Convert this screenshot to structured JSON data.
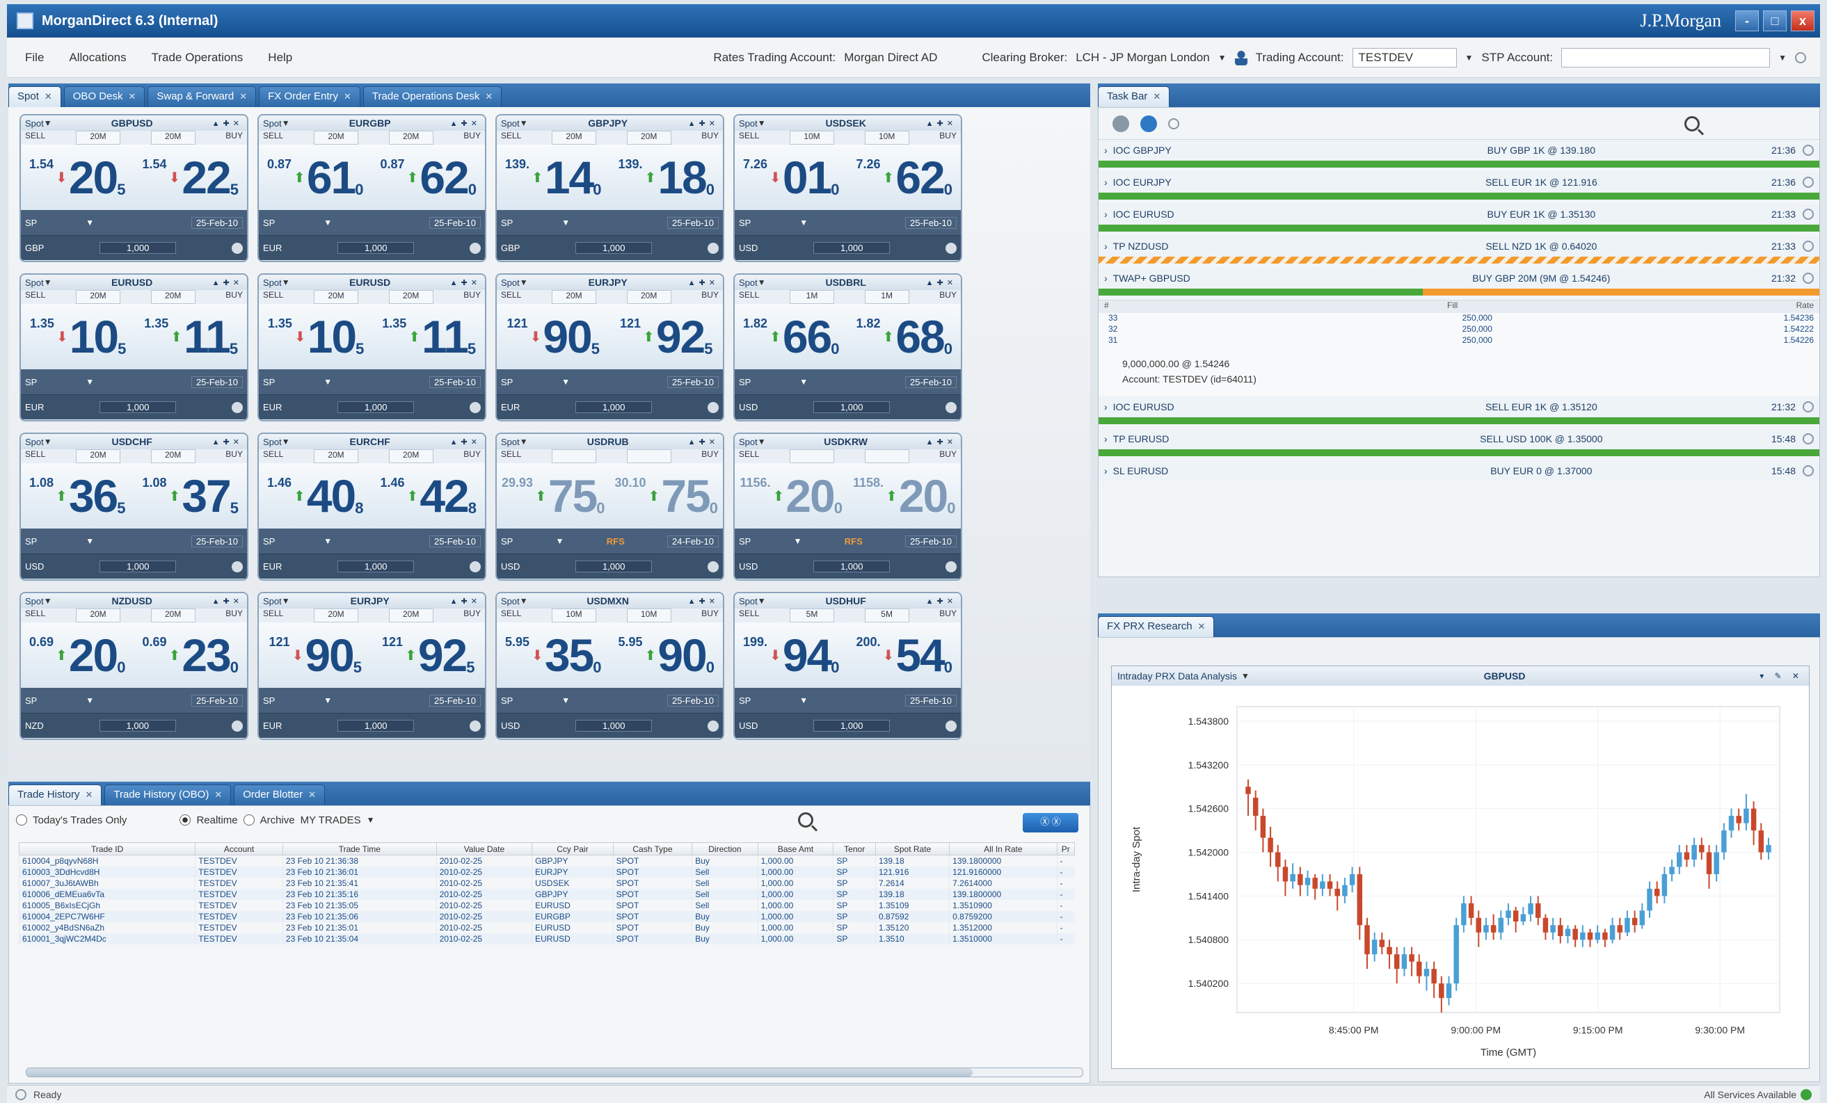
{
  "window": {
    "title": "MorganDirect 6.3 (Internal)",
    "brand": "J.P.Morgan",
    "minimize": "-",
    "maximize": "□",
    "close": "x"
  },
  "menu": {
    "file": "File",
    "allocations": "Allocations",
    "trade_operations": "Trade Operations",
    "help": "Help"
  },
  "context": {
    "rates_account_label": "Rates Trading Account:",
    "rates_account": "Morgan Direct AD",
    "clearing_label": "Clearing Broker:",
    "clearing_value": "LCH - JP Morgan London",
    "trading_label": "Trading Account:",
    "trading_value": "TESTDEV",
    "stp_label": "STP Account:",
    "stp_value": ""
  },
  "main_tabs": [
    {
      "label": "Spot"
    },
    {
      "label": "OBO Desk"
    },
    {
      "label": "Swap & Forward"
    },
    {
      "label": "FX Order Entry"
    },
    {
      "label": "Trade Operations Desk"
    }
  ],
  "tiles": [
    {
      "mode": "Spot",
      "pair": "GBPUSD",
      "sell": "SELL",
      "buy": "BUY",
      "sell_amt": "20M",
      "buy_amt": "20M",
      "bid_pre": "1.54",
      "bid_big": "20",
      "bid_pip": "5",
      "ask_pre": "1.54",
      "ask_big": "22",
      "ask_pip": "5",
      "bid_dir": "down",
      "ask_dir": "down",
      "tenor": "SP",
      "date": "25-Feb-10",
      "ccy": "GBP",
      "amount": "1,000",
      "rfs": "",
      "faded": false
    },
    {
      "mode": "Spot",
      "pair": "EURGBP",
      "sell": "SELL",
      "buy": "BUY",
      "sell_amt": "20M",
      "buy_amt": "20M",
      "bid_pre": "0.87",
      "bid_big": "61",
      "bid_pip": "0",
      "ask_pre": "0.87",
      "ask_big": "62",
      "ask_pip": "0",
      "bid_dir": "up",
      "ask_dir": "up",
      "tenor": "SP",
      "date": "25-Feb-10",
      "ccy": "EUR",
      "amount": "1,000",
      "rfs": "",
      "faded": false
    },
    {
      "mode": "Spot",
      "pair": "GBPJPY",
      "sell": "SELL",
      "buy": "BUY",
      "sell_amt": "20M",
      "buy_amt": "20M",
      "bid_pre": "139.",
      "bid_big": "14",
      "bid_pip": "0",
      "ask_pre": "139.",
      "ask_big": "18",
      "ask_pip": "0",
      "bid_dir": "up",
      "ask_dir": "up",
      "tenor": "SP",
      "date": "25-Feb-10",
      "ccy": "GBP",
      "amount": "1,000",
      "rfs": "",
      "faded": false
    },
    {
      "mode": "Spot",
      "pair": "USDSEK",
      "sell": "SELL",
      "buy": "BUY",
      "sell_amt": "10M",
      "buy_amt": "10M",
      "bid_pre": "7.26",
      "bid_big": "01",
      "bid_pip": "0",
      "ask_pre": "7.26",
      "ask_big": "62",
      "ask_pip": "0",
      "bid_dir": "down",
      "ask_dir": "up",
      "tenor": "SP",
      "date": "25-Feb-10",
      "ccy": "USD",
      "amount": "1,000",
      "rfs": "",
      "faded": false
    },
    {
      "mode": "Spot",
      "pair": "EURUSD",
      "sell": "SELL",
      "buy": "BUY",
      "sell_amt": "20M",
      "buy_amt": "20M",
      "bid_pre": "1.35",
      "bid_big": "10",
      "bid_pip": "5",
      "ask_pre": "1.35",
      "ask_big": "11",
      "ask_pip": "5",
      "bid_dir": "down",
      "ask_dir": "up",
      "tenor": "SP",
      "date": "25-Feb-10",
      "ccy": "EUR",
      "amount": "1,000",
      "rfs": "",
      "faded": false
    },
    {
      "mode": "Spot",
      "pair": "EURUSD",
      "sell": "SELL",
      "buy": "BUY",
      "sell_amt": "20M",
      "buy_amt": "20M",
      "bid_pre": "1.35",
      "bid_big": "10",
      "bid_pip": "5",
      "ask_pre": "1.35",
      "ask_big": "11",
      "ask_pip": "5",
      "bid_dir": "down",
      "ask_dir": "up",
      "tenor": "SP",
      "date": "25-Feb-10",
      "ccy": "EUR",
      "amount": "1,000",
      "rfs": "",
      "faded": false
    },
    {
      "mode": "Spot",
      "pair": "EURJPY",
      "sell": "SELL",
      "buy": "BUY",
      "sell_amt": "20M",
      "buy_amt": "20M",
      "bid_pre": "121",
      "bid_big": "90",
      "bid_pip": "5",
      "ask_pre": "121",
      "ask_big": "92",
      "ask_pip": "5",
      "bid_dir": "down",
      "ask_dir": "up",
      "tenor": "SP",
      "date": "25-Feb-10",
      "ccy": "EUR",
      "amount": "1,000",
      "rfs": "",
      "faded": false
    },
    {
      "mode": "Spot",
      "pair": "USDBRL",
      "sell": "SELL",
      "buy": "BUY",
      "sell_amt": "1M",
      "buy_amt": "1M",
      "bid_pre": "1.82",
      "bid_big": "66",
      "bid_pip": "0",
      "ask_pre": "1.82",
      "ask_big": "68",
      "ask_pip": "0",
      "bid_dir": "up",
      "ask_dir": "up",
      "tenor": "SP",
      "date": "25-Feb-10",
      "ccy": "USD",
      "amount": "1,000",
      "rfs": "",
      "faded": false
    },
    {
      "mode": "Spot",
      "pair": "USDCHF",
      "sell": "SELL",
      "buy": "BUY",
      "sell_amt": "20M",
      "buy_amt": "20M",
      "bid_pre": "1.08",
      "bid_big": "36",
      "bid_pip": "5",
      "ask_pre": "1.08",
      "ask_big": "37",
      "ask_pip": "5",
      "bid_dir": "up",
      "ask_dir": "up",
      "tenor": "SP",
      "date": "25-Feb-10",
      "ccy": "USD",
      "amount": "1,000",
      "rfs": "",
      "faded": false
    },
    {
      "mode": "Spot",
      "pair": "EURCHF",
      "sell": "SELL",
      "buy": "BUY",
      "sell_amt": "20M",
      "buy_amt": "20M",
      "bid_pre": "1.46",
      "bid_big": "40",
      "bid_pip": "8",
      "ask_pre": "1.46",
      "ask_big": "42",
      "ask_pip": "8",
      "bid_dir": "up",
      "ask_dir": "up",
      "tenor": "SP",
      "date": "25-Feb-10",
      "ccy": "EUR",
      "amount": "1,000",
      "rfs": "",
      "faded": false
    },
    {
      "mode": "Spot",
      "pair": "USDRUB",
      "sell": "SELL",
      "buy": "BUY",
      "sell_amt": "",
      "buy_amt": "",
      "bid_pre": "29.93",
      "bid_big": "75",
      "bid_pip": "0",
      "ask_pre": "30.10",
      "ask_big": "75",
      "ask_pip": "0",
      "bid_dir": "up",
      "ask_dir": "up",
      "tenor": "SP",
      "date": "24-Feb-10",
      "ccy": "USD",
      "amount": "1,000",
      "rfs": "RFS",
      "faded": true
    },
    {
      "mode": "Spot",
      "pair": "USDKRW",
      "sell": "SELL",
      "buy": "BUY",
      "sell_amt": "",
      "buy_amt": "",
      "bid_pre": "1156.",
      "bid_big": "20",
      "bid_pip": "0",
      "ask_pre": "1158.",
      "ask_big": "20",
      "ask_pip": "0",
      "bid_dir": "up",
      "ask_dir": "up",
      "tenor": "SP",
      "date": "25-Feb-10",
      "ccy": "USD",
      "amount": "1,000",
      "rfs": "RFS",
      "faded": true
    },
    {
      "mode": "Spot",
      "pair": "NZDUSD",
      "sell": "SELL",
      "buy": "BUY",
      "sell_amt": "20M",
      "buy_amt": "20M",
      "bid_pre": "0.69",
      "bid_big": "20",
      "bid_pip": "0",
      "ask_pre": "0.69",
      "ask_big": "23",
      "ask_pip": "0",
      "bid_dir": "up",
      "ask_dir": "up",
      "tenor": "SP",
      "date": "25-Feb-10",
      "ccy": "NZD",
      "amount": "1,000",
      "rfs": "",
      "faded": false
    },
    {
      "mode": "Spot",
      "pair": "EURJPY",
      "sell": "SELL",
      "buy": "BUY",
      "sell_amt": "20M",
      "buy_amt": "20M",
      "bid_pre": "121",
      "bid_big": "90",
      "bid_pip": "5",
      "ask_pre": "121",
      "ask_big": "92",
      "ask_pip": "5",
      "bid_dir": "down",
      "ask_dir": "up",
      "tenor": "SP",
      "date": "25-Feb-10",
      "ccy": "EUR",
      "amount": "1,000",
      "rfs": "",
      "faded": false
    },
    {
      "mode": "Spot",
      "pair": "USDMXN",
      "sell": "SELL",
      "buy": "BUY",
      "sell_amt": "10M",
      "buy_amt": "10M",
      "bid_pre": "5.95",
      "bid_big": "35",
      "bid_pip": "0",
      "ask_pre": "5.95",
      "ask_big": "90",
      "ask_pip": "0",
      "bid_dir": "down",
      "ask_dir": "up",
      "tenor": "SP",
      "date": "25-Feb-10",
      "ccy": "USD",
      "amount": "1,000",
      "rfs": "",
      "faded": false
    },
    {
      "mode": "Spot",
      "pair": "USDHUF",
      "sell": "SELL",
      "buy": "BUY",
      "sell_amt": "5M",
      "buy_amt": "5M",
      "bid_pre": "199.",
      "bid_big": "94",
      "bid_pip": "0",
      "ask_pre": "200.",
      "ask_big": "54",
      "ask_pip": "0",
      "bid_dir": "down",
      "ask_dir": "down",
      "tenor": "SP",
      "date": "25-Feb-10",
      "ccy": "USD",
      "amount": "1,000",
      "rfs": "",
      "faded": false
    }
  ],
  "bottom_tabs": [
    {
      "label": "Trade History"
    },
    {
      "label": "Trade History (OBO)"
    },
    {
      "label": "Order Blotter"
    }
  ],
  "trade_filter": {
    "todays_only": "Today's Trades Only",
    "realtime": "Realtime",
    "archive": "Archive",
    "scope": "MY TRADES",
    "button": "Ⓧ Ⓧ"
  },
  "trade_table": {
    "columns": [
      "Trade ID",
      "Account",
      "Trade Time",
      "Value Date",
      "Ccy Pair",
      "Cash Type",
      "Direction",
      "Base Amt",
      "Tenor",
      "Spot Rate",
      "All In Rate",
      "Pr"
    ],
    "rows": [
      [
        "610004_p8qyvN68H",
        "TESTDEV",
        "23 Feb 10 21:36:38",
        "2010-02-25",
        "GBPJPY",
        "SPOT",
        "Buy",
        "1,000.00",
        "SP",
        "139.18",
        "139.1800000",
        "-"
      ],
      [
        "610003_3DdHcvd8H",
        "TESTDEV",
        "23 Feb 10 21:36:01",
        "2010-02-25",
        "EURJPY",
        "SPOT",
        "Sell",
        "1,000.00",
        "SP",
        "121.916",
        "121.9160000",
        "-"
      ],
      [
        "610007_3uJ6tAWBh",
        "TESTDEV",
        "23 Feb 10 21:35:41",
        "2010-02-25",
        "USDSEK",
        "SPOT",
        "Sell",
        "1,000.00",
        "SP",
        "7.2614",
        "7.2614000",
        "-"
      ],
      [
        "610006_dEMEua6vTa",
        "TESTDEV",
        "23 Feb 10 21:35:16",
        "2010-02-25",
        "GBPJPY",
        "SPOT",
        "Sell",
        "1,000.00",
        "SP",
        "139.18",
        "139.1800000",
        "-"
      ],
      [
        "610005_B6xIsECjGh",
        "TESTDEV",
        "23 Feb 10 21:35:05",
        "2010-02-25",
        "EURUSD",
        "SPOT",
        "Sell",
        "1,000.00",
        "SP",
        "1.35109",
        "1.3510900",
        "-"
      ],
      [
        "610004_2EPC7W6HF",
        "TESTDEV",
        "23 Feb 10 21:35:06",
        "2010-02-25",
        "EURGBP",
        "SPOT",
        "Buy",
        "1,000.00",
        "SP",
        "0.87592",
        "0.8759200",
        "-"
      ],
      [
        "610002_y4BdSN6aZh",
        "TESTDEV",
        "23 Feb 10 21:35:01",
        "2010-02-25",
        "EURUSD",
        "SPOT",
        "Buy",
        "1,000.00",
        "SP",
        "1.35120",
        "1.3512000",
        "-"
      ],
      [
        "610001_3qjWC2M4Dc",
        "TESTDEV",
        "23 Feb 10 21:35:04",
        "2010-02-25",
        "EURUSD",
        "SPOT",
        "Buy",
        "1,000.00",
        "SP",
        "1.3510",
        "1.3510000",
        "-"
      ]
    ]
  },
  "task_tabs": [
    {
      "label": "Task Bar"
    }
  ],
  "tasks": [
    {
      "name": "IOC GBPJPY",
      "desc": "BUY GBP 1K @ 139.180",
      "time": "21:36",
      "bar": "green"
    },
    {
      "name": "IOC EURJPY",
      "desc": "SELL EUR 1K @ 121.916",
      "time": "21:36",
      "bar": "green"
    },
    {
      "name": "IOC EURUSD",
      "desc": "BUY EUR 1K @ 1.35130",
      "time": "21:33",
      "bar": "green"
    },
    {
      "name": "TP NZDUSD",
      "desc": "SELL NZD 1K @ 0.64020",
      "time": "21:33",
      "bar": "hatch"
    },
    {
      "name": "TWAP+ GBPUSD",
      "desc": "BUY GBP 20M (9M @ 1.54246)",
      "time": "21:32",
      "bar": "split"
    }
  ],
  "fills": {
    "hdr_id": "#",
    "hdr_fill": "Fill",
    "hdr_rate": "Rate",
    "rows": [
      [
        "33",
        "250,000",
        "1.54236"
      ],
      [
        "32",
        "250,000",
        "1.54222"
      ],
      [
        "31",
        "250,000",
        "1.54226"
      ]
    ],
    "summary": "9,000,000.00 @ 1.54246",
    "account_label": "Account:",
    "account": "TESTDEV (id=64011)"
  },
  "tasks2": [
    {
      "name": "IOC EURUSD",
      "desc": "SELL EUR 1K @ 1.35120",
      "time": "21:32",
      "bar": "green"
    },
    {
      "name": "TP EURUSD",
      "desc": "SELL USD 100K @ 1.35000",
      "time": "15:48",
      "bar": "green"
    },
    {
      "name": "SL EURUSD",
      "desc": "BUY EUR 0 @ 1.37000",
      "time": "15:48",
      "bar": "none"
    }
  ],
  "research_tabs": [
    {
      "label": "FX PRX Research"
    }
  ],
  "chart_header": {
    "left": "Intraday PRX Data Analysis",
    "center": "GBPUSD",
    "controls": "▾ ✎ ✕"
  },
  "chart_data": {
    "type": "candlestick",
    "title": "GBPUSD",
    "xlabel": "Time (GMT)",
    "ylabel": "Intra-day Spot",
    "ylim": [
      1.5398,
      1.544
    ],
    "yticks": [
      "1.543800",
      "1.543200",
      "1.542600",
      "1.542000",
      "1.541400",
      "1.540800",
      "1.540200"
    ],
    "xticks": [
      "8:45:00 PM",
      "9:00:00 PM",
      "9:15:00 PM",
      "9:30:00 PM"
    ],
    "xrange": [
      "8:35:00 PM",
      "9:37:00 PM"
    ],
    "up_color": "#4a9fd6",
    "down_color": "#c9482b",
    "candles": [
      [
        1.5429,
        1.5428,
        1.5425,
        1.543
      ],
      [
        1.54275,
        1.5425,
        1.5423,
        1.54285
      ],
      [
        1.5425,
        1.5422,
        1.542,
        1.5426
      ],
      [
        1.5422,
        1.542,
        1.5418,
        1.54235
      ],
      [
        1.542,
        1.5418,
        1.5416,
        1.5421
      ],
      [
        1.5418,
        1.5416,
        1.5414,
        1.5419
      ],
      [
        1.5416,
        1.5417,
        1.5415,
        1.54185
      ],
      [
        1.5417,
        1.54155,
        1.5414,
        1.5418
      ],
      [
        1.54155,
        1.54165,
        1.5414,
        1.54175
      ],
      [
        1.54165,
        1.5415,
        1.54135,
        1.5417
      ],
      [
        1.5415,
        1.5416,
        1.5414,
        1.5417
      ],
      [
        1.5416,
        1.5415,
        1.5414,
        1.5417
      ],
      [
        1.5415,
        1.5414,
        1.5412,
        1.5416
      ],
      [
        1.5414,
        1.54155,
        1.5413,
        1.54165
      ],
      [
        1.54155,
        1.5417,
        1.54145,
        1.5418
      ],
      [
        1.5417,
        1.541,
        1.5408,
        1.5418
      ],
      [
        1.541,
        1.5406,
        1.5404,
        1.5411
      ],
      [
        1.5406,
        1.5408,
        1.5405,
        1.5409
      ],
      [
        1.5408,
        1.5407,
        1.5406,
        1.5409
      ],
      [
        1.5407,
        1.5406,
        1.5404,
        1.5408
      ],
      [
        1.5406,
        1.5404,
        1.5402,
        1.5407
      ],
      [
        1.5404,
        1.5406,
        1.5403,
        1.5407
      ],
      [
        1.5406,
        1.5405,
        1.5403,
        1.5407
      ],
      [
        1.5405,
        1.5403,
        1.5402,
        1.5406
      ],
      [
        1.5403,
        1.5404,
        1.5401,
        1.5405
      ],
      [
        1.5404,
        1.5402,
        1.54,
        1.5405
      ],
      [
        1.5402,
        1.54,
        1.5398,
        1.5403
      ],
      [
        1.54,
        1.5402,
        1.5399,
        1.5403
      ],
      [
        1.5402,
        1.541,
        1.5401,
        1.5411
      ],
      [
        1.541,
        1.5413,
        1.5409,
        1.5414
      ],
      [
        1.5413,
        1.5411,
        1.541,
        1.5414
      ],
      [
        1.5411,
        1.5409,
        1.5407,
        1.5412
      ],
      [
        1.5409,
        1.541,
        1.5408,
        1.5411
      ],
      [
        1.541,
        1.5409,
        1.5408,
        1.54115
      ],
      [
        1.5409,
        1.5411,
        1.5408,
        1.5412
      ],
      [
        1.5411,
        1.5412,
        1.541,
        1.5413
      ],
      [
        1.5412,
        1.54105,
        1.5409,
        1.54125
      ],
      [
        1.54105,
        1.54115,
        1.541,
        1.54125
      ],
      [
        1.54115,
        1.5413,
        1.54105,
        1.5414
      ],
      [
        1.5413,
        1.5411,
        1.541,
        1.5414
      ],
      [
        1.5411,
        1.5409,
        1.5408,
        1.54115
      ],
      [
        1.5409,
        1.541,
        1.5408,
        1.5411
      ],
      [
        1.541,
        1.54085,
        1.54075,
        1.5411
      ],
      [
        1.54085,
        1.54095,
        1.54075,
        1.541
      ],
      [
        1.54095,
        1.5408,
        1.5407,
        1.541
      ],
      [
        1.5408,
        1.5409,
        1.5407,
        1.541
      ],
      [
        1.5409,
        1.5408,
        1.5407,
        1.54095
      ],
      [
        1.5408,
        1.5409,
        1.54075,
        1.541
      ],
      [
        1.5409,
        1.5408,
        1.5407,
        1.54095
      ],
      [
        1.5408,
        1.541,
        1.54075,
        1.5411
      ],
      [
        1.541,
        1.5409,
        1.5408,
        1.5411
      ],
      [
        1.5409,
        1.5411,
        1.54085,
        1.5412
      ],
      [
        1.5411,
        1.541,
        1.5409,
        1.5412
      ],
      [
        1.541,
        1.5412,
        1.54095,
        1.5413
      ],
      [
        1.5412,
        1.5415,
        1.5411,
        1.5416
      ],
      [
        1.5415,
        1.5414,
        1.5413,
        1.5416
      ],
      [
        1.5414,
        1.5417,
        1.5413,
        1.5418
      ],
      [
        1.5417,
        1.5418,
        1.5416,
        1.5419
      ],
      [
        1.5418,
        1.542,
        1.5417,
        1.5421
      ],
      [
        1.542,
        1.5419,
        1.5418,
        1.5421
      ],
      [
        1.5419,
        1.5421,
        1.5418,
        1.5422
      ],
      [
        1.5421,
        1.542,
        1.5419,
        1.5422
      ],
      [
        1.542,
        1.5417,
        1.5415,
        1.5421
      ],
      [
        1.5417,
        1.542,
        1.5416,
        1.5421
      ],
      [
        1.542,
        1.5423,
        1.5419,
        1.5424
      ],
      [
        1.5423,
        1.5425,
        1.5422,
        1.5426
      ],
      [
        1.5425,
        1.5424,
        1.5423,
        1.5426
      ],
      [
        1.5424,
        1.5426,
        1.5423,
        1.5428
      ],
      [
        1.5426,
        1.5423,
        1.5421,
        1.5427
      ],
      [
        1.5423,
        1.542,
        1.5419,
        1.5424
      ],
      [
        1.542,
        1.5421,
        1.5419,
        1.5422
      ]
    ]
  },
  "status": {
    "ready": "Ready",
    "services": "All Services Available"
  }
}
